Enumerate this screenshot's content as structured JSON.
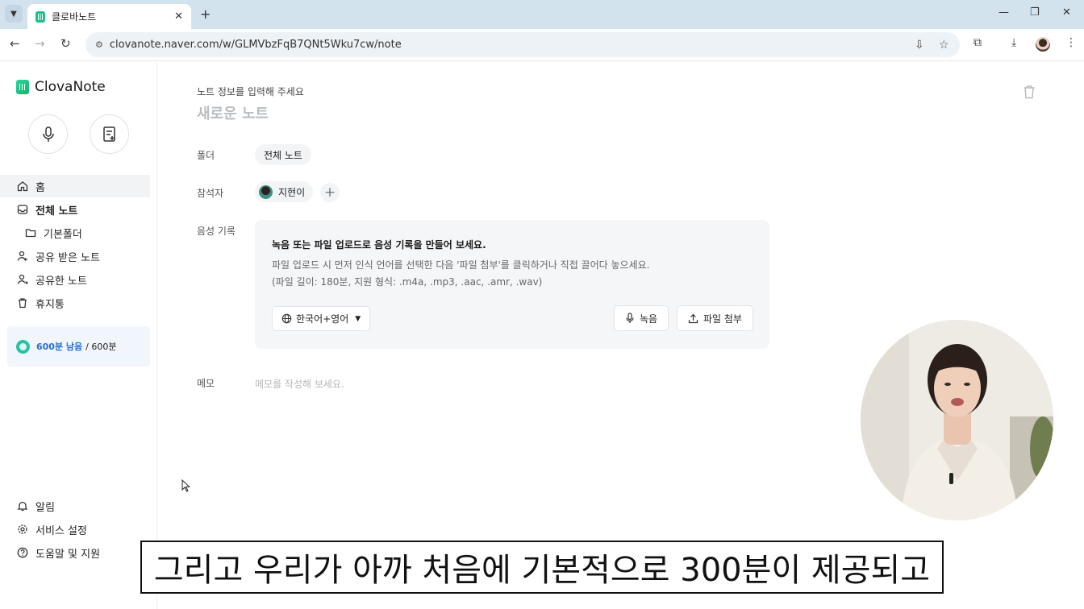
{
  "browser": {
    "tab_title": "클로바노트",
    "url": "clovanote.naver.com/w/GLMVbzFqB7QNt5Wku7cw/note"
  },
  "sidebar": {
    "logo_text": "ClovaNote",
    "items": [
      {
        "label": "홈",
        "icon": "home-icon"
      },
      {
        "label": "전체 노트",
        "icon": "inbox-icon"
      },
      {
        "label": "기본폴더",
        "icon": "folder-icon"
      },
      {
        "label": "공유 받은 노트",
        "icon": "person-share-in-icon"
      },
      {
        "label": "공유한 노트",
        "icon": "person-share-out-icon"
      },
      {
        "label": "휴지통",
        "icon": "trash-icon"
      }
    ],
    "usage": {
      "remaining": "600분 남음",
      "total": "/ 600분"
    },
    "bottom_items": [
      {
        "label": "알림",
        "icon": "bell-icon"
      },
      {
        "label": "서비스 설정",
        "icon": "gear-icon"
      },
      {
        "label": "도움말 및 지원",
        "icon": "help-icon"
      }
    ]
  },
  "note": {
    "info_prompt": "노트 정보를 입력해 주세요",
    "title_placeholder": "새로운 노트",
    "folder_label": "폴더",
    "folder_value": "전체 노트",
    "participants_label": "참석자",
    "participant_name": "지현이",
    "recording_label": "음성 기록",
    "recording_title": "녹음 또는 파일 업로드로 음성 기록을 만들어 보세요.",
    "recording_desc_1": "파일 업로드 시 먼저 인식 언어를 선택한 다음 '파일 첨부'를 클릭하거나 직접 끌어다 놓으세요.",
    "recording_desc_2": "(파일 길이: 180분, 지원 형식: .m4a, .mp3, .aac, .amr, .wav)",
    "language_value": "한국어+영어",
    "record_button": "녹음",
    "attach_button": "파일 첨부",
    "memo_label": "메모",
    "memo_placeholder": "메모를 작성해 보세요."
  },
  "caption": "그리고 우리가 아까 처음에 기본적으로 300분이 제공되고"
}
